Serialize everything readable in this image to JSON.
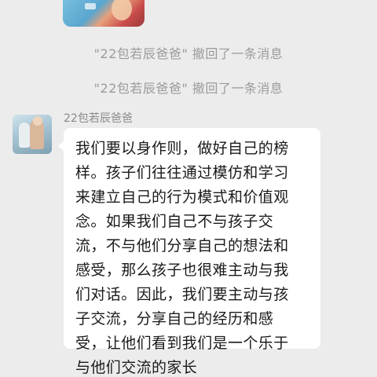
{
  "recall_notices": [
    "\"22包若辰爸爸\" 撤回了一条消息",
    "\"22包若辰爸爸\" 撤回了一条消息"
  ],
  "message": {
    "sender": "22包若辰爸爸",
    "lines": [
      "我们要以身作则，做好自己的榜",
      "样。孩子们往往通过模仿和学习",
      "来建立自己的行为模式和价值观",
      "念。如果我们自己不与孩子交",
      "流，不与他们分享自己的想法和",
      "感受，那么孩子也很难主动与我",
      "们对话。因此，我们要主动与孩",
      "子交流，分享自己的经历和感",
      "受，让他们看到我们是一个乐于",
      "与他们交流的家长"
    ]
  },
  "colors": {
    "background": "#ececec",
    "bubble": "#ffffff",
    "system_text": "#9b9b9b",
    "message_text": "#1a1a1a"
  }
}
